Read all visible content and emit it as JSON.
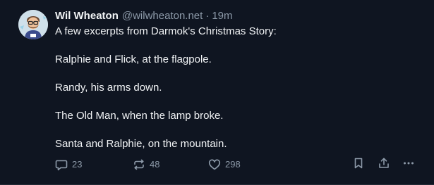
{
  "post": {
    "author": {
      "display_name": "Wil Wheaton",
      "handle": "@wilwheaton.net",
      "separator": "·",
      "time": "19m"
    },
    "paragraphs": [
      "A few excerpts from Darmok's Christmas Story:",
      "Ralphie and Flick, at the flagpole.",
      "Randy, his arms down.",
      "The Old Man, when the lamp broke.",
      "Santa and Ralphie, on the mountain."
    ],
    "actions": {
      "reply": {
        "icon": "reply-icon",
        "count": "23"
      },
      "repost": {
        "icon": "repost-icon",
        "count": "48"
      },
      "like": {
        "icon": "heart-icon",
        "count": "298"
      },
      "bookmark": {
        "icon": "bookmark-icon"
      },
      "share": {
        "icon": "share-icon"
      },
      "more": {
        "icon": "more-options-icon"
      }
    }
  },
  "colors": {
    "background": "#0f1521",
    "text": "#f1f3f5",
    "muted": "#8d9aa9"
  }
}
